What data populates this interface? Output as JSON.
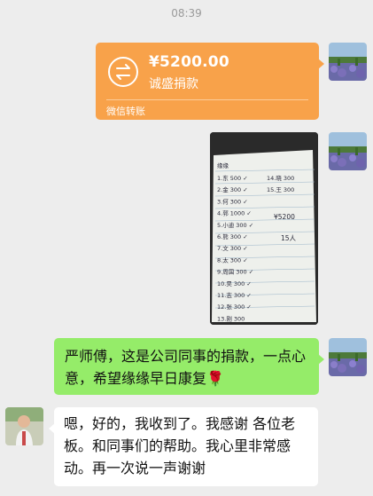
{
  "status": {
    "time": "08:39"
  },
  "transfer": {
    "amount": "¥5200.00",
    "note": "诚盛捐款",
    "footer": "微信转账",
    "icon": "transfer-arrows-icon",
    "color": "#f8a24a"
  },
  "photo": {
    "caption": "缘缘",
    "rows": [
      {
        "no": "1.",
        "name": "东",
        "amount": "500"
      },
      {
        "no": "2.",
        "name": "金",
        "amount": "300"
      },
      {
        "no": "3.",
        "name": "何",
        "amount": "300"
      },
      {
        "no": "4.",
        "name": "郭",
        "amount": "1000"
      },
      {
        "no": "5.",
        "name": "小迪",
        "amount": "300"
      },
      {
        "no": "6.",
        "name": "熊",
        "amount": "300"
      },
      {
        "no": "7.",
        "name": "文",
        "amount": "300"
      },
      {
        "no": "8.",
        "name": "太",
        "amount": "300"
      },
      {
        "no": "9.",
        "name": "周国",
        "amount": "300"
      },
      {
        "no": "10.",
        "name": "昊",
        "amount": "300"
      },
      {
        "no": "11.",
        "name": "志",
        "amount": "300"
      },
      {
        "no": "12.",
        "name": "张",
        "amount": "300"
      },
      {
        "no": "13.",
        "name": "刚",
        "amount": "300"
      }
    ],
    "side_rows": [
      {
        "no": "14.",
        "name": "晓",
        "amount": "300"
      },
      {
        "no": "15.",
        "name": "王",
        "amount": "300"
      }
    ],
    "total": "5200",
    "people": "15人"
  },
  "messages": {
    "outgoing_text": "严师傅，这是公司同事的捐款，一点心意，希望缘缘早日康复",
    "outgoing_emoji": "🌹",
    "incoming_text": "嗯，好的，我收到了。我感谢 各位老板。和同事们的帮助。我心里非常感动。再一次说一声谢谢"
  },
  "colors": {
    "chat_bg": "#ededed",
    "outgoing_bubble": "#95ec69",
    "incoming_bubble": "#ffffff"
  }
}
